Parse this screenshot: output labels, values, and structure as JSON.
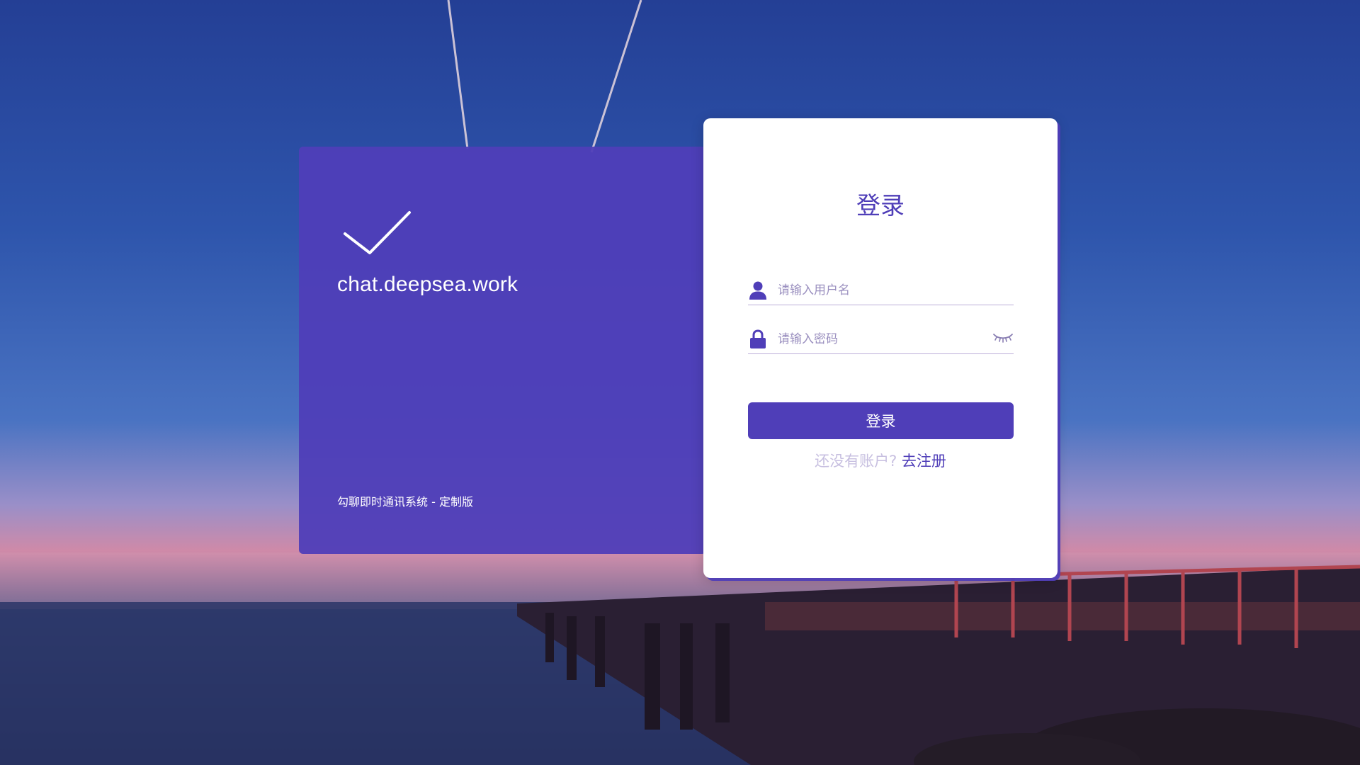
{
  "brand": {
    "site_title": "chat.deepsea.work",
    "footer": "勾聊即时通讯系统 - 定制版",
    "logo_icon": "checkmark-icon"
  },
  "login": {
    "title": "登录",
    "username_placeholder": "请输入用户名",
    "password_placeholder": "请输入密码",
    "submit_label": "登录",
    "register_hint": "还没有账户?",
    "register_link": "去注册"
  },
  "icons": {
    "username": "user-icon",
    "password": "lock-icon",
    "toggle_password": "eye-closed-icon"
  },
  "colors": {
    "accent": "#4f3eb8",
    "card_left": "#4f3eb8",
    "card_right": "#ffffff",
    "hint": "#c7bfe0"
  }
}
